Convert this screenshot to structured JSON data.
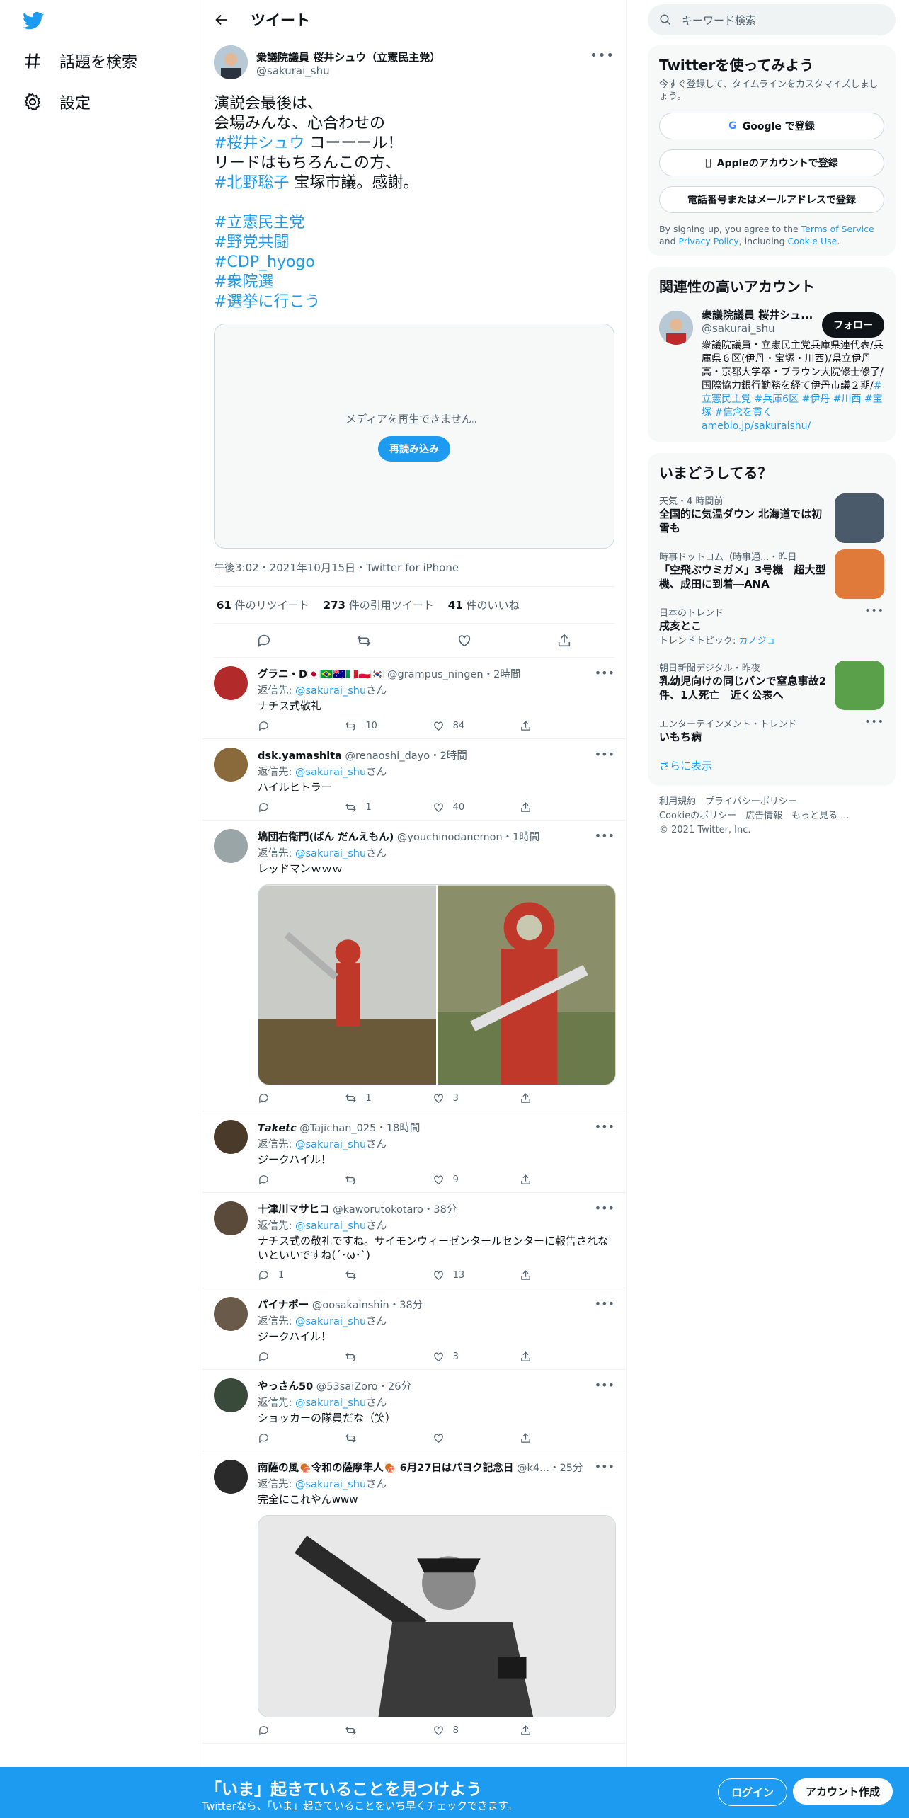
{
  "nav": {
    "explore": "話題を検索",
    "settings": "設定"
  },
  "header": {
    "title": "ツイート"
  },
  "focal": {
    "name": "衆議院議員 桜井シュウ（立憲民主党）",
    "handle": "@sakurai_shu",
    "lines": [
      {
        "text": "演説会最後は、"
      },
      {
        "text": "会場みんな、心合わせの"
      },
      {
        "tag": "#桜井シュウ",
        "text": " コーーール！"
      },
      {
        "text": "リードはもちろんこの方、"
      },
      {
        "tag": "#北野聡子",
        "text": " 宝塚市議。感謝。"
      },
      {
        "text": " "
      },
      {
        "tag": "#立憲民主党"
      },
      {
        "tag": "#野党共闘"
      },
      {
        "tag": "#CDP_hyogo"
      },
      {
        "tag": "#衆院選"
      },
      {
        "tag": "#選挙に行こう"
      }
    ],
    "media_error": "メディアを再生できません。",
    "reload": "再読み込み",
    "meta": "午後3:02・2021年10月15日・Twitter for iPhone",
    "retweets": "61",
    "retweets_label": "件のリツイート",
    "quotes": "273",
    "quotes_label": "件の引用ツイート",
    "likes": "41",
    "likes_label": "件のいいね"
  },
  "replies": [
    {
      "name": "グラニ・D🇯🇵🇧🇷🇦🇺🇮🇹🇵🇱🇰🇷",
      "handle": "@grampus_ningen",
      "time": "・2時間",
      "reply_to": "@sakurai_shu",
      "text": "ナチス式敬礼",
      "rt": "10",
      "like": "84",
      "avatar": "#b32a2a"
    },
    {
      "name": "dsk.yamashita",
      "handle": "@renaoshi_dayo",
      "time": "・2時間",
      "reply_to": "@sakurai_shu",
      "text": "ハイルヒトラー",
      "rt": "1",
      "like": "40",
      "avatar": "#8a6a3a"
    },
    {
      "name": "塙団右衛門(ばん だんえもん)",
      "handle": "@youchinodanemon",
      "time": "・1時間",
      "reply_to": "@sakurai_shu",
      "text": "レッドマンｗｗｗ",
      "rt": "1",
      "like": "3",
      "avatar": "#9aa5a8",
      "images": true
    },
    {
      "name": "𝙏𝙖𝙠𝙚𝙩𝙘",
      "handle": "@Tajichan_025",
      "time": "・18時間",
      "reply_to": "@sakurai_shu",
      "text": "ジークハイル！",
      "rt": "",
      "like": "9",
      "avatar": "#4a3a2a"
    },
    {
      "name": "十津川マサヒコ",
      "handle": "@kaworutokotaro",
      "time": "・38分",
      "reply_to": "@sakurai_shu",
      "text": "ナチス式の敬礼ですね。サイモンウィーゼンタールセンターに報告されないといいですね(´･ω･`)",
      "reply": "1",
      "rt": "",
      "like": "13",
      "avatar": "#5a4a3a"
    },
    {
      "name": "パイナポー",
      "handle": "@oosakainshin",
      "time": "・38分",
      "reply_to": "@sakurai_shu",
      "text": "ジークハイル！",
      "rt": "",
      "like": "3",
      "avatar": "#6a5a4a"
    },
    {
      "name": "やっさん50",
      "handle": "@53saiZoro",
      "time": "・26分",
      "reply_to": "@sakurai_shu",
      "text": "ショッカーの隊員だな（笑）",
      "rt": "",
      "like": "",
      "avatar": "#3a4a3a"
    },
    {
      "name": "南薩の風🍖令和の薩摩隼人🍖 6月27日はパヨク記念日",
      "handle": "@k4...",
      "time": "・25分",
      "reply_to": "@sakurai_shu",
      "text": "完全にこれやんwww",
      "rt": "",
      "like": "8",
      "avatar": "#2a2a2a",
      "photo": true
    }
  ],
  "reply_to_label": "返信先: ",
  "reply_to_suffix": "さん",
  "sidebar": {
    "search_placeholder": "キーワード検索",
    "signup_card": {
      "title": "Twitterを使ってみよう",
      "sub": "今すぐ登録して、タイムラインをカスタマイズしましょう。",
      "google": "Google で登録",
      "apple": "Appleのアカウントで登録",
      "phone": "電話番号またはメールアドレスで登録",
      "terms_a": "By signing up, you agree to the ",
      "terms_link": "Terms of Service",
      "terms_b": " and ",
      "privacy_link": "Privacy Policy",
      "terms_c": ", including ",
      "cookie_link": "Cookie Use",
      "terms_d": "."
    },
    "related": {
      "title": "関連性の高いアカウント",
      "name": "衆議院議員 桜井シュ...",
      "handle": "@sakurai_shu",
      "follow": "フォロー",
      "bio": "衆議院議員・立憲民主党兵庫県連代表/兵庫県６区(伊丹・宝塚・川西)/県立伊丹高・京都大学卒・ブラウン大院修士修了/国際協力銀行勤務を経て伊丹市議２期/",
      "bio_tags": "#立憲民主党 #兵庫6区 #伊丹 #川西 #宝塚 #信念を貫く",
      "bio_link": "ameblo.jp/sakuraishu/"
    },
    "trends": {
      "title": "いまどうしてる？",
      "items": [
        {
          "meta": "天気・4 時間前",
          "text": "全国的に気温ダウン 北海道では初雪も",
          "thumb": "#4a5a6a"
        },
        {
          "meta": "時事ドットコム（時事通...・昨日",
          "text": "「空飛ぶウミガメ」3号機　超大型機、成田に到着―ANA",
          "thumb": "#e07a3a"
        },
        {
          "meta": "日本のトレンド",
          "text": "戌亥とこ",
          "sub": "トレンドトピック: ",
          "sub_link": "カノジョ"
        },
        {
          "meta": "朝日新聞デジタル・昨夜",
          "text": "乳幼児向けの同じパンで窒息事故2件、1人死亡　近く公表へ",
          "thumb": "#5aa04a"
        },
        {
          "meta": "エンターテインメント・トレンド",
          "text": "いもち病"
        }
      ],
      "more": "さらに表示"
    },
    "footer": {
      "l1": "利用規約　プライバシーポリシー",
      "l2": "Cookieのポリシー　広告情報　もっと見る ...",
      "l3": "© 2021 Twitter, Inc."
    }
  },
  "bottom": {
    "title": "「いま」起きていることを見つけよう",
    "sub": "Twitterなら、「いま」起きていることをいち早くチェックできます。",
    "login": "ログイン",
    "signup": "アカウント作成"
  }
}
